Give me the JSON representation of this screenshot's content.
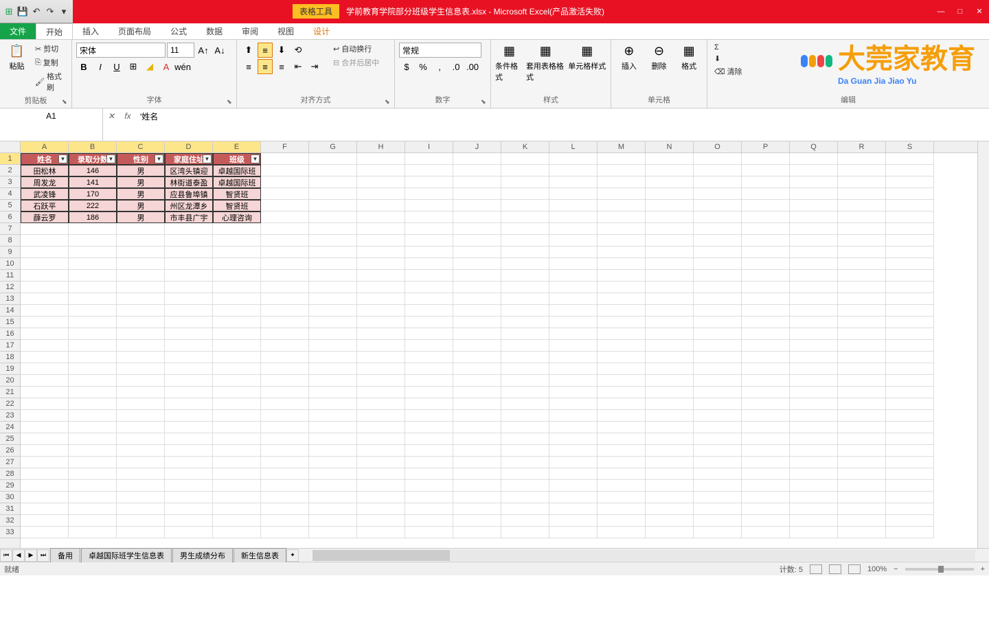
{
  "titlebar": {
    "tools_label": "表格工具",
    "filename": "学前教育学院部分班级学生信息表.xlsx - Microsoft Excel(产品激活失败)"
  },
  "tabs": {
    "file": "文件",
    "home": "开始",
    "insert": "插入",
    "layout": "页面布局",
    "formula": "公式",
    "data": "数据",
    "review": "审阅",
    "view": "视图",
    "design": "设计"
  },
  "ribbon": {
    "clipboard": {
      "label": "剪贴板",
      "paste": "粘贴",
      "cut": "剪切",
      "copy": "复制",
      "format_painter": "格式刷"
    },
    "font": {
      "label": "字体",
      "name": "宋体",
      "size": "11"
    },
    "align": {
      "label": "对齐方式",
      "wrap": "自动换行",
      "merge": "合并后居中"
    },
    "number": {
      "label": "数字",
      "format": "常规"
    },
    "styles": {
      "label": "样式",
      "cond": "条件格式",
      "table": "套用表格格式",
      "cell": "单元格样式"
    },
    "cells": {
      "label": "单元格",
      "insert": "插入",
      "delete": "删除",
      "format": "格式"
    },
    "editing": {
      "label": "编辑",
      "clear": "清除"
    }
  },
  "watermark": {
    "main": "大莞家教育",
    "sub": "Da Guan Jia Jiao Yu"
  },
  "formula": {
    "cell_ref": "A1",
    "value": "'姓名"
  },
  "columns": [
    "A",
    "B",
    "C",
    "D",
    "E",
    "F",
    "G",
    "H",
    "I",
    "J",
    "K",
    "L",
    "M",
    "N",
    "O",
    "P",
    "Q",
    "R",
    "S"
  ],
  "table": {
    "headers": [
      "姓名",
      "录取分数",
      "性别",
      "家庭住址",
      "班级"
    ],
    "rows": [
      [
        "田松林",
        "146",
        "男",
        "区湾头镇迎",
        "卓越国际班"
      ],
      [
        "周发龙",
        "141",
        "男",
        "林街道泰盈",
        "卓越国际班"
      ],
      [
        "武凌锋",
        "170",
        "男",
        "应县鲁埠镇",
        "智贤班"
      ],
      [
        "石跃平",
        "222",
        "男",
        "州区龙潭乡",
        "智贤班"
      ],
      [
        "薛云罗",
        "186",
        "男",
        "市丰县广宇",
        "心理咨询"
      ]
    ]
  },
  "sheets": [
    "备用",
    "卓越国际班学生信息表",
    "男生成绩分布",
    "新生信息表"
  ],
  "status": {
    "ready": "就绪",
    "count": "计数: 5",
    "zoom": "100%"
  }
}
